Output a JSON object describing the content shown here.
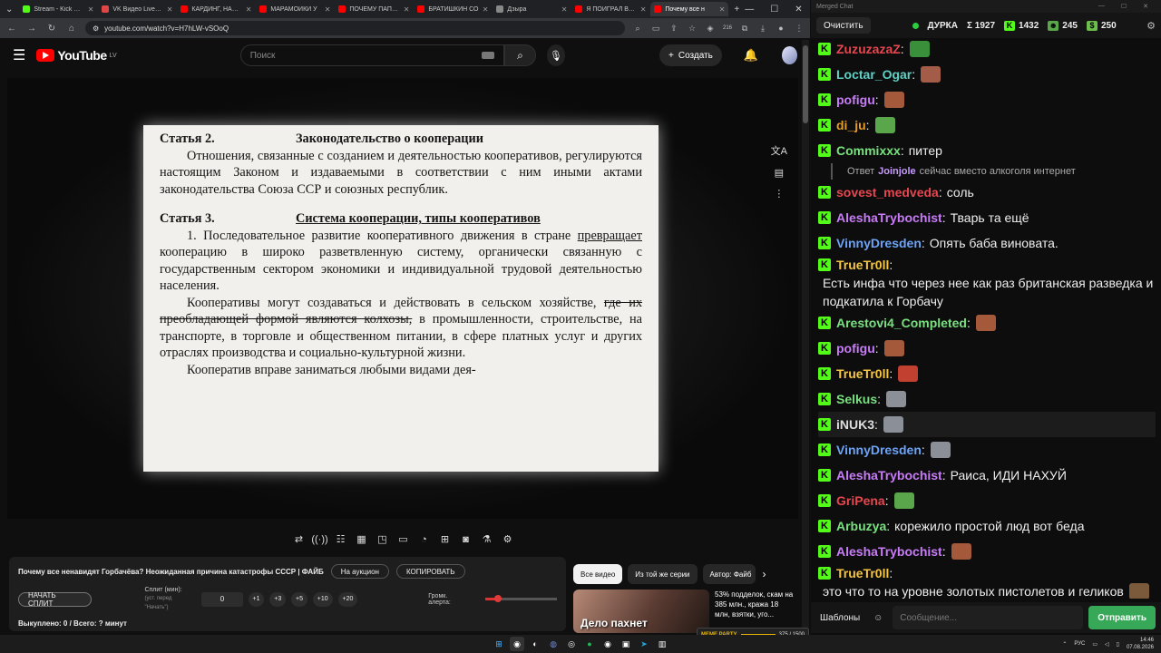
{
  "browser": {
    "tabs": [
      {
        "title": "Stream - Kick Das",
        "color": "#53fc18",
        "active": false
      },
      {
        "title": "VK Видео Live —",
        "color": "#e04646",
        "active": false
      },
      {
        "title": "КАРДИНГ, НАКРУ",
        "color": "#ff0000",
        "active": false
      },
      {
        "title": "МАРАМОЙКИ У",
        "color": "#ff0000",
        "active": false
      },
      {
        "title": "ПОЧЕМУ ПАПА Т",
        "color": "#ff0000",
        "active": false
      },
      {
        "title": "БРАТИШКИН СО",
        "color": "#ff0000",
        "active": false
      },
      {
        "title": "Дзыра",
        "color": "#888888",
        "active": false
      },
      {
        "title": "Я ПОИГРАЛ В WI",
        "color": "#ff0000",
        "active": false
      },
      {
        "title": "Почему все н",
        "color": "#ff0000",
        "active": true
      }
    ],
    "url": "youtube.com/watch?v=H7hLW-vSOoQ",
    "ext_badge": "216"
  },
  "youtube": {
    "logo": "YouTube",
    "region": "LV",
    "search_placeholder": "Поиск",
    "create_label": "Создать"
  },
  "document": {
    "art2_num": "Статья 2.",
    "art2_title": "Законодательство о кооперации",
    "art2_text": "Отношения, связанные с созданием и деятельностью кооперативов, регулируются настоящим Законом и издаваемыми в соответствии с ним иными актами законодательства Союза ССР и союзных республик.",
    "art3_num": "Статья 3.",
    "art3_title": "Система кооперации, типы кооперативов",
    "p1_a": "1. Последовательное развитие кооперативного движения в стране ",
    "p1_ul": "превращает",
    "p1_b": " кооперацию в широко разветвленную систему, органически связанную с государственным сектором экономики и индивидуальной трудовой деятельностью населения.",
    "p2_a": "Кооперативы могут создаваться и действовать в сельском хозяйстве, ",
    "p2_st": "где их преобладающей формой являются колхозы,",
    "p2_b": " в промышленности, строительстве, на транспорте, в торговле и общественном питании, в сфере платных услуг и других отраслях производства и социально-культурной жизни.",
    "p3": "Кооператив вправе заниматься любыми видами дея-"
  },
  "panel": {
    "video_title": "Почему все ненавидят Горбачёва? Неожиданная причина катастрофы СССР | ФАЙБ",
    "auction_btn": "На аукцион",
    "copy_btn": "КОПИРОВАТЬ",
    "split_btn": "НАЧАТЬ СПЛИТ",
    "split_label": "Сплит (мин):",
    "split_hint": "(уст. перед \"Начать\")",
    "split_value": "0",
    "increments": [
      "+1",
      "+3",
      "+5",
      "+10",
      "+20"
    ],
    "volume_label": "Громк. алерта:",
    "volume_level": 0.18,
    "bought": "Выкуплено: 0 / Всего: ? минут"
  },
  "chips": [
    "Все видео",
    "Из той же серии",
    "Автор: Файб"
  ],
  "recommended": {
    "thumb_caption": "Дело пахнет",
    "title": "53% подделок, скам на 385 млн., кража 18 млн, взятки, уго..."
  },
  "chat": {
    "window_title": "Merged Chat",
    "clear_btn": "Очистить",
    "channel": "ДУРКА",
    "sigma": "Σ 1927",
    "kick_count": "1432",
    "count2": "245",
    "count3": "250",
    "messages": [
      {
        "name": "ZuzuzazaZ",
        "color": "#e8464f",
        "text": "",
        "emote": "#3a8f3a"
      },
      {
        "name": "Loctar_Ogar",
        "color": "#5fd0c5",
        "text": "",
        "emote": "#a35c47"
      },
      {
        "name": "pofigu",
        "color": "#c87cf7",
        "text": "",
        "emote": "#a5593b"
      },
      {
        "name": "di_ju",
        "color": "#e39b2c",
        "text": "",
        "emote": "#5aa64a"
      },
      {
        "name": "Commixxx",
        "color": "#79e07f",
        "text": "питер",
        "emote": ""
      },
      {
        "name": "sovest_medveda",
        "color": "#e8464f",
        "text": "соль",
        "emote": ""
      },
      {
        "name": "AleshaTrybochist",
        "color": "#c87cf7",
        "text": "Тварь та ещё",
        "emote": ""
      },
      {
        "name": "VinnyDresden",
        "color": "#6ca3f7",
        "text": "Опять баба виновата.",
        "emote": ""
      },
      {
        "name": "TrueTr0ll",
        "color": "#f5c542",
        "text": "Есть инфа что через нее как раз британская разведка и подкатила к Горбачу",
        "emote": ""
      },
      {
        "name": "Arestovi4_Completed",
        "color": "#79e07f",
        "text": "",
        "emote": "#a5593b"
      },
      {
        "name": "pofigu",
        "color": "#c87cf7",
        "text": "",
        "emote": "#a5593b"
      },
      {
        "name": "TrueTr0ll",
        "color": "#f5c542",
        "text": "",
        "emote": "#c2402f"
      },
      {
        "name": "Selkus",
        "color": "#79e07f",
        "text": "",
        "emote": "#8a8f98"
      },
      {
        "name": "iNUK3",
        "color": "#dddddd",
        "text": "",
        "emote": "#8a8f98"
      },
      {
        "name": "VinnyDresden",
        "color": "#6ca3f7",
        "text": "",
        "emote": "#8a8f98"
      },
      {
        "name": "AleshaTrybochist",
        "color": "#c87cf7",
        "text": "Раиса, ИДИ НАХУЙ",
        "emote": ""
      },
      {
        "name": "GriPena",
        "color": "#e8464f",
        "text": "",
        "emote": "#5aa64a"
      },
      {
        "name": "Arbuzya",
        "color": "#79e07f",
        "text": "корежило простой люд вот беда",
        "emote": ""
      },
      {
        "name": "AleshaTrybochist",
        "color": "#c87cf7",
        "text": "",
        "emote": "#a5593b"
      },
      {
        "name": "TrueTr0ll",
        "color": "#f5c542",
        "text": "это что то на уровне золотых пистолетов и геликов",
        "emote": "#7a5a3a"
      }
    ],
    "reply": {
      "prefix": "Ответ",
      "user": "Joinjole",
      "text": "сейчас вместо алкоголя интернет"
    },
    "templates_btn": "Шаблоны",
    "input_placeholder": "Сообщение...",
    "send_btn": "Отправить"
  },
  "meme_party": {
    "label": "MEME PARTY",
    "progress": "375 / 1500"
  },
  "taskbar": {
    "lang": "РУС",
    "time": "14:46",
    "date": "07.08.2026"
  }
}
